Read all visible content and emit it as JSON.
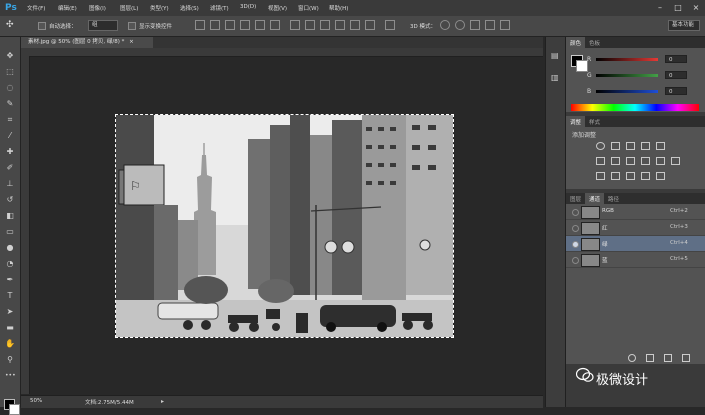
{
  "app": {
    "logo": "Ps"
  },
  "menu": [
    "文件(F)",
    "编辑(E)",
    "图像(I)",
    "图层(L)",
    "类型(Y)",
    "选择(S)",
    "滤镜(T)",
    "3D(D)",
    "视图(V)",
    "窗口(W)",
    "帮助(H)"
  ],
  "window_controls": [
    "–",
    "□",
    "×"
  ],
  "options_bar": {
    "auto_select_label": "自动选择：",
    "auto_select_value": "组",
    "show_transform_label": "显示变换控件",
    "mode_3d_label": "3D 模式：",
    "workspace": "基本功能"
  },
  "document": {
    "tab_title": "素材.jpg @ 50% (图层 0 拷贝, 绿/8) *",
    "close": "×",
    "zoom": "50%",
    "doc_size": "文档:2.75M/5.44M"
  },
  "color_panel": {
    "tabs": [
      "颜色",
      "色板"
    ],
    "channels": [
      {
        "label": "R",
        "value": "0",
        "color": "#e53935"
      },
      {
        "label": "G",
        "value": "0",
        "color": "#43a047"
      },
      {
        "label": "B",
        "value": "0",
        "color": "#1e4fd8"
      }
    ]
  },
  "adjust_panel": {
    "tabs": [
      "调整",
      "样式"
    ],
    "title": "添加调整"
  },
  "channels_panel": {
    "tabs": [
      "图层",
      "通道",
      "路径"
    ],
    "rows": [
      {
        "name": "RGB",
        "shortcut": "Ctrl+2",
        "active": false
      },
      {
        "name": "红",
        "shortcut": "Ctrl+3",
        "active": false
      },
      {
        "name": "绿",
        "shortcut": "Ctrl+4",
        "active": true
      },
      {
        "name": "蓝",
        "shortcut": "Ctrl+5",
        "active": false
      }
    ]
  },
  "watermark": "极微设计"
}
